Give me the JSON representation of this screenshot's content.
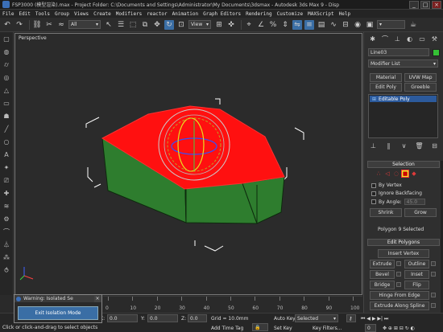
{
  "window": {
    "title": "FSP3000 (模型渲染).max  - Project Folder: C:\\Documents and Settings\\Administrator\\My Documents\\3dsmax   - Autodesk 3ds Max 9   - Disp",
    "minimize": "_",
    "maximize": "□",
    "close": "×"
  },
  "menu": [
    "File",
    "Edit",
    "Tools",
    "Group",
    "Views",
    "Create",
    "Modifiers",
    "reactor",
    "Animation",
    "Graph Editors",
    "Rendering",
    "Customize",
    "MAXScript",
    "Help"
  ],
  "toolbar": {
    "filter": "All",
    "refcoord": "View",
    "icons": [
      "undo-icon",
      "redo-icon",
      "link-icon",
      "unlink-icon",
      "bind-icon",
      "select-icon",
      "select-name-icon",
      "rect-select-icon",
      "window-crossing-icon",
      "move-icon",
      "rotate-icon",
      "scale-icon"
    ]
  },
  "viewport": {
    "label": "Perspective",
    "colors": {
      "top": "#ff1010",
      "side": "#2e7d2e",
      "gizmo": "#cccccc",
      "bbox": "#ffffff"
    }
  },
  "command_panel": {
    "object_name": "Line03",
    "object_color": "#35c035",
    "modifier_list": "Modifier List",
    "buttons": [
      "Material",
      "UVW Map",
      "Edit Poly",
      "Greeble"
    ],
    "stack_item": "Editable Poly",
    "selection_title": "Selection",
    "by_vertex": "By Vertex",
    "ignore_backfacing": "Ignore Backfacing",
    "by_angle": "By Angle:",
    "angle_value": "45.0",
    "shrink": "Shrink",
    "grow": "Grow",
    "selection_status": "Polygon 9 Selected",
    "edit_polygons_title": "Edit Polygons",
    "insert_vertex": "Insert Vertex",
    "ops": [
      [
        "Extrude",
        "Outline"
      ],
      [
        "Bevel",
        "Inset"
      ],
      [
        "Bridge",
        "Flip"
      ]
    ],
    "hinge": "Hinge From Edge",
    "extrude_spline": "Extrude Along Spline"
  },
  "timeline": {
    "ticks": [
      0,
      10,
      20,
      30,
      40,
      50,
      60,
      70,
      80,
      90,
      100
    ],
    "end": 100
  },
  "status": {
    "x_label": "X:",
    "x": "0.0",
    "y_label": "Y:",
    "y": "0.0",
    "z_label": "Z:",
    "z": "0.0",
    "grid": "Grid = 10.0mm",
    "add_time_tag": "Add Time Tag",
    "autokey": "Auto Key",
    "setkey": "Set Key",
    "selected": "Selected",
    "key_filters": "Key Filters...",
    "prompt": "Click or click-and-drag to select objects",
    "frame": "0"
  },
  "iso_dialog": {
    "title": "Warning: Isolated Se",
    "close": "×",
    "button": "Exit Isolation Mode"
  }
}
